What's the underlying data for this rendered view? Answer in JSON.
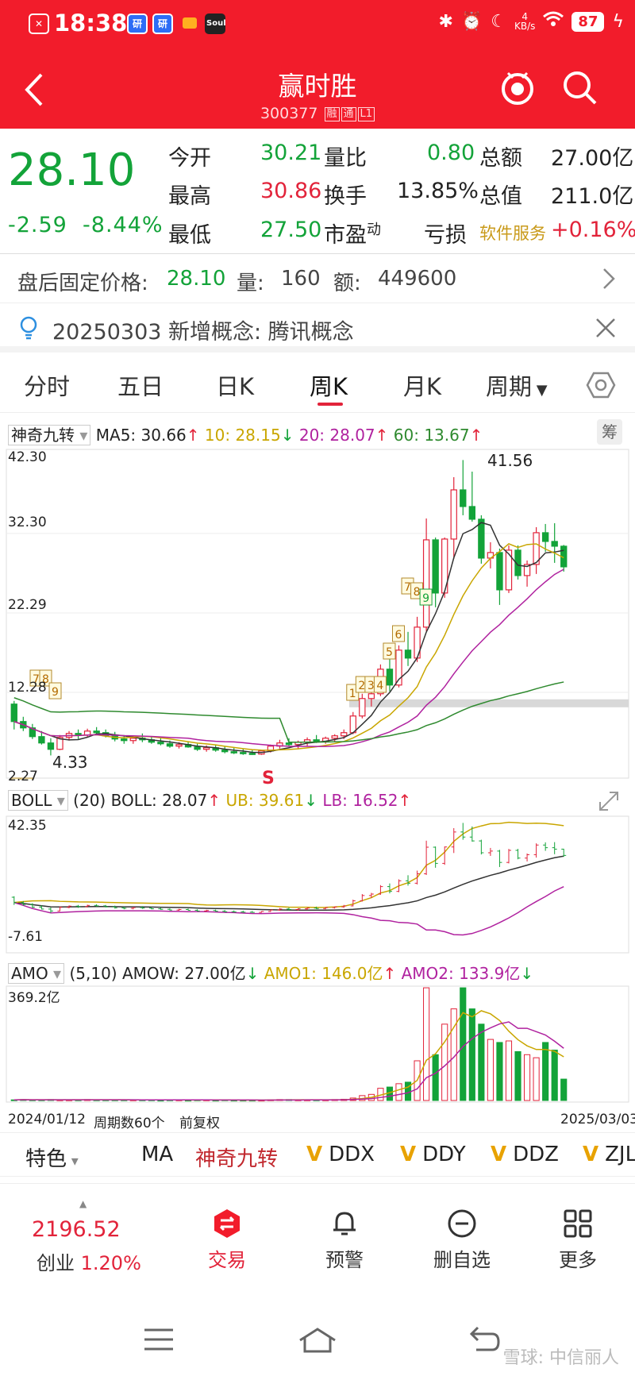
{
  "status_bar": {
    "time": "18:38",
    "net_speed": "4\nKB/s",
    "battery": "87"
  },
  "header": {
    "title": "赢时胜",
    "code": "300377",
    "tag1": "融",
    "tag2": "通",
    "tag3": "L1"
  },
  "quote": {
    "price": "28.10",
    "change": "-2.59",
    "change_pct": "-8.44%",
    "open_label": "今开",
    "open": "30.21",
    "high_label": "最高",
    "high": "30.86",
    "low_label": "最低",
    "low": "27.50",
    "vol_ratio_label": "量比",
    "vol_ratio": "0.80",
    "turnover_label": "换手",
    "turnover": "13.85%",
    "pe_label": "市盈",
    "pe_sup": "动",
    "pe": "亏损",
    "amount_label": "总额",
    "amount": "27.00亿",
    "mktcap_label": "总值",
    "mktcap": "211.0亿",
    "sector": "软件服务",
    "sector_change": "+0.16%"
  },
  "after_hours": {
    "label": "盘后固定价格:",
    "price": "28.10",
    "vol_label": "量:",
    "vol": "160",
    "amt_label": "额:",
    "amt": "449600"
  },
  "concept": {
    "text": "20250303 新增概念: 腾讯概念"
  },
  "tabs": [
    "分时",
    "五日",
    "日K",
    "周K",
    "月K",
    "周期"
  ],
  "main_chart": {
    "indicator": "神奇九转",
    "ma5": "MA5: 30.66",
    "ma10": "10: 28.15",
    "ma20": "20: 28.07",
    "ma60": "60: 13.67",
    "y_top": "42.30",
    "y2": "32.30",
    "y3": "22.29",
    "y4": "12.28",
    "y_bottom": "2.27",
    "max_label": "41.56",
    "min_label": "4.33",
    "s_label": "S",
    "chip": "筹",
    "td_nums": [
      "5",
      "6",
      "7",
      "8",
      "9",
      "1",
      "2",
      "3",
      "4",
      "5",
      "6",
      "7",
      "8",
      "9"
    ]
  },
  "boll": {
    "name": "BOLL",
    "params": "(20) BOLL: 28.07",
    "ub": "UB: 39.61",
    "lb": "LB: 16.52",
    "y_top": "42.35",
    "y_bottom": "-7.61"
  },
  "amo": {
    "name": "AMO",
    "params": "(5,10) AMOW: 27.00亿",
    "amo1": "AMO1: 146.0亿",
    "amo2": "AMO2: 133.9亿",
    "y_top": "369.2亿"
  },
  "axis": {
    "start": "2024/01/12",
    "count": "周期数60个",
    "adj": "前复权",
    "end": "2025/03/03"
  },
  "toolbar": {
    "feature": "特色",
    "ma": "MA",
    "td": "神奇九转",
    "ddx": "DDX",
    "ddy": "DDY",
    "ddz": "DDZ",
    "zjl": "ZJL"
  },
  "bottom_nav": {
    "index_value": "2196.52",
    "index_name": "创业",
    "index_change": "1.20%",
    "trade": "交易",
    "alert": "预警",
    "del_watch": "删自选",
    "more": "更多"
  },
  "watermark": "雪球: 中信丽人",
  "colors": {
    "brand_red": "#f21c2b",
    "up": "#e2233a",
    "down": "#13a339",
    "ma10": "#c9a600",
    "ma20": "#b0229f",
    "ma60": "#2f8a2f"
  },
  "chart_data": {
    "type": "candlestick",
    "period": "weekly",
    "ylim": [
      2.27,
      42.3
    ],
    "x_start": "2024/01/12",
    "x_end": "2025/03/03",
    "candles": [
      {
        "o": 10.8,
        "h": 11.2,
        "l": 7.6,
        "c": 8.6
      },
      {
        "o": 8.6,
        "h": 9.2,
        "l": 7.4,
        "c": 7.8
      },
      {
        "o": 7.8,
        "h": 8.3,
        "l": 6.4,
        "c": 6.7
      },
      {
        "o": 6.7,
        "h": 7.4,
        "l": 5.7,
        "c": 5.9
      },
      {
        "o": 5.9,
        "h": 6.5,
        "l": 4.33,
        "c": 5.1
      },
      {
        "o": 5.1,
        "h": 6.9,
        "l": 5.0,
        "c": 6.6
      },
      {
        "o": 6.6,
        "h": 7.4,
        "l": 6.2,
        "c": 7.1
      },
      {
        "o": 7.1,
        "h": 7.6,
        "l": 6.4,
        "c": 6.9
      },
      {
        "o": 6.9,
        "h": 7.7,
        "l": 6.6,
        "c": 7.4
      },
      {
        "o": 7.4,
        "h": 7.9,
        "l": 6.9,
        "c": 7.2
      },
      {
        "o": 7.2,
        "h": 7.6,
        "l": 6.6,
        "c": 6.8
      },
      {
        "o": 6.8,
        "h": 7.3,
        "l": 6.1,
        "c": 6.4
      },
      {
        "o": 6.4,
        "h": 6.9,
        "l": 5.8,
        "c": 6.2
      },
      {
        "o": 6.2,
        "h": 6.8,
        "l": 5.8,
        "c": 6.5
      },
      {
        "o": 6.5,
        "h": 7.1,
        "l": 6.0,
        "c": 6.3
      },
      {
        "o": 6.3,
        "h": 6.7,
        "l": 5.8,
        "c": 6.0
      },
      {
        "o": 6.0,
        "h": 6.5,
        "l": 5.6,
        "c": 5.8
      },
      {
        "o": 5.8,
        "h": 6.2,
        "l": 5.3,
        "c": 5.5
      },
      {
        "o": 5.5,
        "h": 6.0,
        "l": 5.2,
        "c": 5.7
      },
      {
        "o": 5.7,
        "h": 6.1,
        "l": 5.3,
        "c": 5.4
      },
      {
        "o": 5.4,
        "h": 5.8,
        "l": 4.9,
        "c": 5.1
      },
      {
        "o": 5.1,
        "h": 5.6,
        "l": 4.8,
        "c": 5.3
      },
      {
        "o": 5.3,
        "h": 5.7,
        "l": 4.8,
        "c": 5.0
      },
      {
        "o": 5.0,
        "h": 5.5,
        "l": 4.6,
        "c": 4.8
      },
      {
        "o": 4.8,
        "h": 5.3,
        "l": 4.5,
        "c": 4.7
      },
      {
        "o": 4.7,
        "h": 5.2,
        "l": 4.4,
        "c": 4.6
      },
      {
        "o": 4.6,
        "h": 5.1,
        "l": 4.4,
        "c": 4.5
      },
      {
        "o": 4.5,
        "h": 5.0,
        "l": 4.4,
        "c": 4.9
      },
      {
        "o": 4.9,
        "h": 5.7,
        "l": 4.7,
        "c": 5.5
      },
      {
        "o": 5.5,
        "h": 6.3,
        "l": 5.2,
        "c": 5.9
      },
      {
        "o": 5.9,
        "h": 6.5,
        "l": 5.4,
        "c": 5.7
      },
      {
        "o": 5.7,
        "h": 6.2,
        "l": 5.2,
        "c": 6.0
      },
      {
        "o": 6.0,
        "h": 6.6,
        "l": 5.5,
        "c": 6.3
      },
      {
        "o": 6.3,
        "h": 6.9,
        "l": 5.9,
        "c": 6.1
      },
      {
        "o": 6.1,
        "h": 6.7,
        "l": 5.8,
        "c": 6.5
      },
      {
        "o": 6.5,
        "h": 7.0,
        "l": 6.1,
        "c": 6.8
      },
      {
        "o": 6.8,
        "h": 7.6,
        "l": 6.4,
        "c": 7.2
      },
      {
        "o": 7.2,
        "h": 9.8,
        "l": 7.0,
        "c": 9.3
      },
      {
        "o": 9.3,
        "h": 12.1,
        "l": 9.0,
        "c": 11.5
      },
      {
        "o": 11.5,
        "h": 12.6,
        "l": 10.5,
        "c": 12.1
      },
      {
        "o": 12.1,
        "h": 15.8,
        "l": 11.8,
        "c": 15.2
      },
      {
        "o": 15.2,
        "h": 16.5,
        "l": 12.4,
        "c": 13.2
      },
      {
        "o": 13.2,
        "h": 18.2,
        "l": 12.9,
        "c": 17.6
      },
      {
        "o": 17.6,
        "h": 19.9,
        "l": 15.6,
        "c": 16.6
      },
      {
        "o": 16.6,
        "h": 21.8,
        "l": 16.1,
        "c": 20.5
      },
      {
        "o": 20.5,
        "h": 34.2,
        "l": 20.0,
        "c": 31.5
      },
      {
        "o": 31.5,
        "h": 31.8,
        "l": 23.0,
        "c": 24.8
      },
      {
        "o": 24.8,
        "h": 31.8,
        "l": 24.2,
        "c": 31.6
      },
      {
        "o": 31.6,
        "h": 39.4,
        "l": 29.1,
        "c": 37.8
      },
      {
        "o": 37.8,
        "h": 41.56,
        "l": 34.6,
        "c": 35.7
      },
      {
        "o": 35.7,
        "h": 40.1,
        "l": 33.8,
        "c": 34.1
      },
      {
        "o": 34.1,
        "h": 34.6,
        "l": 28.5,
        "c": 29.2
      },
      {
        "o": 29.2,
        "h": 31.2,
        "l": 27.9,
        "c": 29.9
      },
      {
        "o": 29.9,
        "h": 30.4,
        "l": 23.3,
        "c": 25.2
      },
      {
        "o": 25.2,
        "h": 30.8,
        "l": 24.8,
        "c": 30.2
      },
      {
        "o": 30.2,
        "h": 30.8,
        "l": 26.5,
        "c": 27.0
      },
      {
        "o": 27.0,
        "h": 28.9,
        "l": 25.6,
        "c": 28.4
      },
      {
        "o": 28.4,
        "h": 33.1,
        "l": 27.2,
        "c": 32.4
      },
      {
        "o": 32.4,
        "h": 33.5,
        "l": 30.0,
        "c": 31.3
      },
      {
        "o": 31.3,
        "h": 33.6,
        "l": 28.6,
        "c": 30.7
      },
      {
        "o": 30.7,
        "h": 30.86,
        "l": 27.5,
        "c": 28.1
      }
    ],
    "amo_values": [
      2,
      3,
      2,
      2,
      3,
      2,
      2,
      2,
      3,
      2,
      2,
      2,
      2,
      2,
      2,
      2,
      1,
      2,
      2,
      1,
      2,
      2,
      1,
      2,
      1,
      1,
      1,
      1,
      2,
      3,
      3,
      2,
      2,
      2,
      2,
      3,
      4,
      8,
      16,
      20,
      40,
      44,
      55,
      60,
      130,
      369,
      150,
      250,
      300,
      369,
      300,
      250,
      200,
      190,
      195,
      160,
      150,
      140,
      190,
      165,
      70
    ]
  }
}
